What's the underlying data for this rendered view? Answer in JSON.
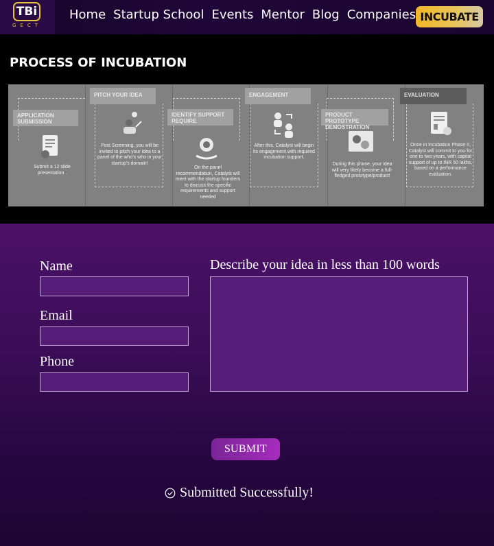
{
  "nav": {
    "logo_text": "TBi",
    "logo_sub": "GECT",
    "links": [
      "Home",
      "Startup School",
      "Events",
      "Mentor",
      "Blog",
      "Companies"
    ],
    "cta_label": "INCUBATE"
  },
  "process": {
    "title": "PROCESS OF INCUBATION",
    "steps": [
      {
        "heading": "APPLICATION SUBMISSION",
        "text": "Submit a 12 slide presentation .",
        "icon": "document-icon"
      },
      {
        "heading": "PITCH YOUR IDEA",
        "text": "Post Screening, you will be invited to pitch your idea to a panel of the who's who in your startup's domain!",
        "icon": "presenter-icon"
      },
      {
        "heading": "IDENTIFY SUPPORT REQUIRE",
        "text": "On the panel recommendation, Catalyst will meet with the startup founders to discuss the specific requirements and support needed",
        "icon": "support-icon"
      },
      {
        "heading": "ENGAGEMENT",
        "text": "After this, Catalyst will begin its engagement with required incubation support.",
        "icon": "engagement-icon"
      },
      {
        "heading": "PRODUCT PROTOTYPE DEMOSTRATION",
        "text": "During this phase, your idea will very likely become a full-fledged prototype/product!",
        "icon": "prototype-icon"
      },
      {
        "heading": "EVALUATION",
        "text": "Once in Incubation Phase II, Catalyst will commit to you for one to two years, with capital support of up to INR 50 lakhs, based on a performance evaluation.",
        "icon": "evaluation-icon"
      }
    ]
  },
  "form": {
    "name_label": "Name",
    "email_label": "Email",
    "phone_label": "Phone",
    "idea_label": "Describe your idea in less than 100 words",
    "name_value": "",
    "email_value": "",
    "phone_value": "",
    "idea_value": "",
    "submit_label": "SUBMIT",
    "success_message": "Submitted Successfully!"
  },
  "colors": {
    "nav_bg": "#1f0638",
    "logo_gold": "#e6c341",
    "cta_gold": "#f2b626",
    "form_bg": "#3a0d56",
    "submit_bg": "#a62cbd"
  }
}
